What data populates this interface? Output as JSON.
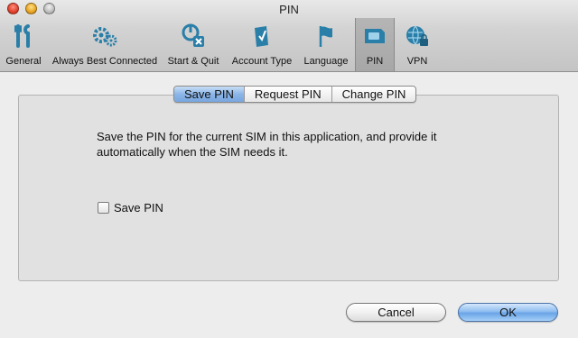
{
  "window": {
    "title": "PIN"
  },
  "toolbar": {
    "items": [
      {
        "label": "General",
        "icon": "tools-icon"
      },
      {
        "label": "Always Best Connected",
        "icon": "gears-icon"
      },
      {
        "label": "Start & Quit",
        "icon": "power-close-icon"
      },
      {
        "label": "Account Type",
        "icon": "account-icon"
      },
      {
        "label": "Language",
        "icon": "flag-icon"
      },
      {
        "label": "PIN",
        "icon": "sim-card-icon",
        "selected": true
      },
      {
        "label": "VPN",
        "icon": "globe-lock-icon"
      }
    ]
  },
  "tabs": [
    {
      "label": "Save PIN",
      "active": true
    },
    {
      "label": "Request PIN",
      "active": false
    },
    {
      "label": "Change PIN",
      "active": false
    }
  ],
  "content": {
    "description_line1": "Save the PIN for the current SIM in this application, and provide it",
    "description_line2": "automatically when the SIM needs it.",
    "checkbox_label": "Save PIN",
    "checkbox_checked": false
  },
  "buttons": {
    "cancel": "Cancel",
    "ok": "OK"
  },
  "colors": {
    "accent": "#78a6e0",
    "toolbar_selected": "#aaaaaa"
  }
}
